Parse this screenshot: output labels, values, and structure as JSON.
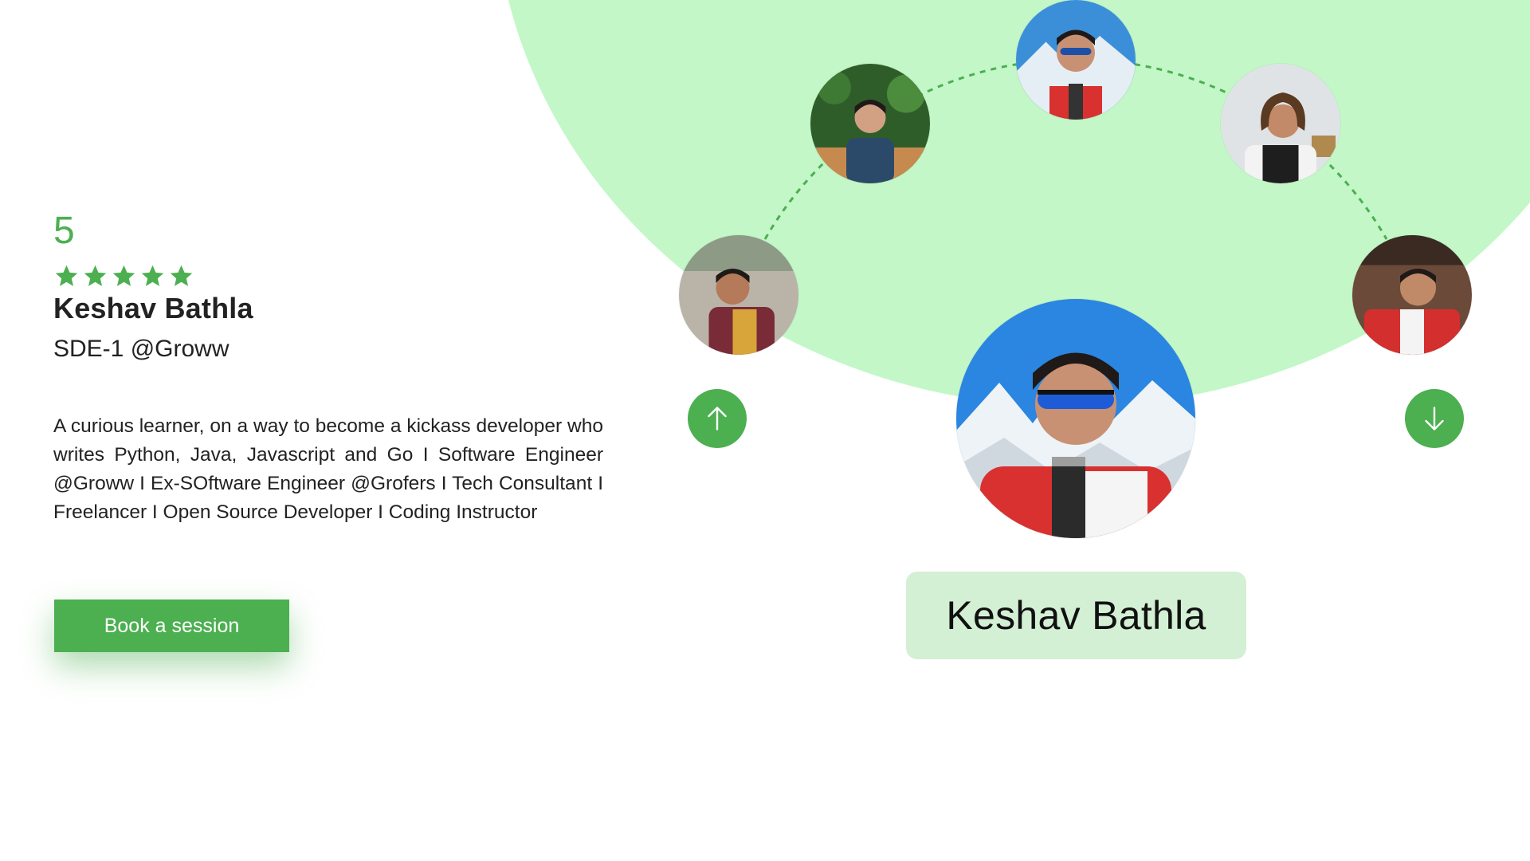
{
  "mentor": {
    "rating": "5",
    "stars": 5,
    "name": "Keshav Bathla",
    "role": "SDE-1 @Groww",
    "bio": "A curious learner, on a way to become a kickass developer who writes Python, Java, Javascript and Go I Software Engineer @Groww I Ex-SOftware Engineer @Grofers I Tech Consultant I Freelancer I Open Source Developer I Coding Instructor",
    "cta_label": "Book a session"
  },
  "carousel": {
    "selected_name": "Keshav Bathla"
  },
  "icons": {
    "prev": "arrow-up-icon",
    "next": "arrow-down-icon",
    "star": "star-icon"
  },
  "colors": {
    "accent": "#4caf50",
    "circle_bg": "#c3f7c7",
    "name_card_bg": "#d3f0d4"
  }
}
